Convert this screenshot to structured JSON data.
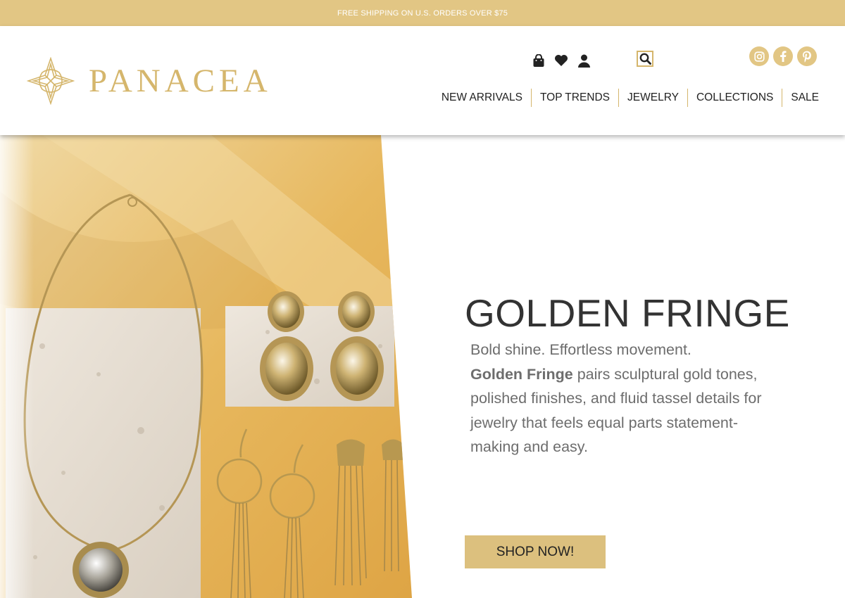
{
  "promo": {
    "text": "FREE SHIPPING ON U.S. ORDERS OVER $75"
  },
  "brand": {
    "name": "PANACEA",
    "accent": "#d5b66c",
    "bar_color": "#e2c684"
  },
  "utility": {
    "icons": [
      "shopping-bag-icon",
      "heart-icon",
      "user-icon",
      "search-icon"
    ]
  },
  "social": {
    "icons": [
      "instagram-icon",
      "facebook-icon",
      "pinterest-icon"
    ]
  },
  "nav": {
    "items": [
      {
        "label": "NEW ARRIVALS"
      },
      {
        "label": "TOP TRENDS"
      },
      {
        "label": "JEWELRY"
      },
      {
        "label": "COLLECTIONS"
      },
      {
        "label": "SALE"
      }
    ]
  },
  "hero": {
    "title": "GOLDEN FRINGE",
    "line1": "Bold shine. Effortless movement.",
    "emphasis": "Golden Fringe",
    "body": "pairs sculptural gold tones, polished finishes, and fluid tassel details for jewelry that feels equal parts statement-making and easy.",
    "cta": "SHOP NOW!"
  }
}
